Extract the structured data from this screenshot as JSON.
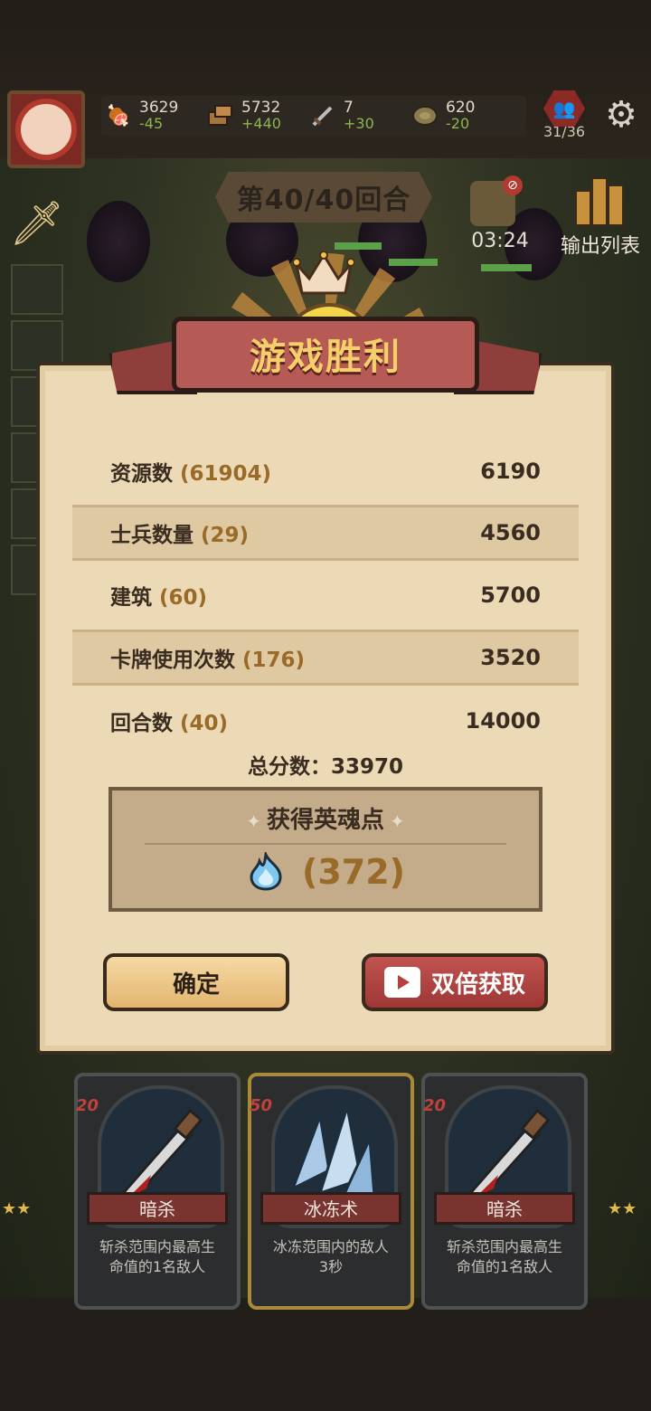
{
  "resources": [
    {
      "icon": "meat-icon",
      "value": "3629",
      "delta": "-45"
    },
    {
      "icon": "wood-icon",
      "value": "5732",
      "delta": "+440"
    },
    {
      "icon": "sword-icon",
      "value": "7",
      "delta": "+30"
    },
    {
      "icon": "coin-icon",
      "value": "620",
      "delta": "-20"
    }
  ],
  "population": "31/36",
  "round": "第40/40回合",
  "timer": "03:24",
  "output_list": "输出列表",
  "title": "游戏胜利",
  "score_rows": [
    {
      "label": "资源数",
      "count": "(61904)",
      "value": "6190"
    },
    {
      "label": "士兵数量",
      "count": "(29)",
      "value": "4560"
    },
    {
      "label": "建筑",
      "count": "(60)",
      "value": "5700"
    },
    {
      "label": "卡牌使用次数",
      "count": "(176)",
      "value": "3520"
    },
    {
      "label": "回合数",
      "count": "(40)",
      "value": "14000"
    }
  ],
  "total": "总分数：33970",
  "soul": {
    "title": "获得英魂点",
    "value": "(372)"
  },
  "buttons": {
    "confirm": "确定",
    "double": "双倍获取"
  },
  "cards": [
    {
      "cost": "20",
      "name": "暗杀",
      "desc_line1": "斩杀范围内最高生",
      "desc_line2": "命值的1名敌人"
    },
    {
      "cost": "50",
      "name": "冰冻术",
      "desc_line1": "冰冻范围内的敌人",
      "desc_line2": "3秒"
    },
    {
      "cost": "20",
      "name": "暗杀",
      "desc_line1": "斩杀范围内最高生",
      "desc_line2": "命值的1名敌人"
    }
  ],
  "colors": {
    "accent_gold": "#9a6a28",
    "title_gold": "#f5d06a",
    "ribbon_red": "#b65a55",
    "parchment": "#ecd9b5"
  }
}
